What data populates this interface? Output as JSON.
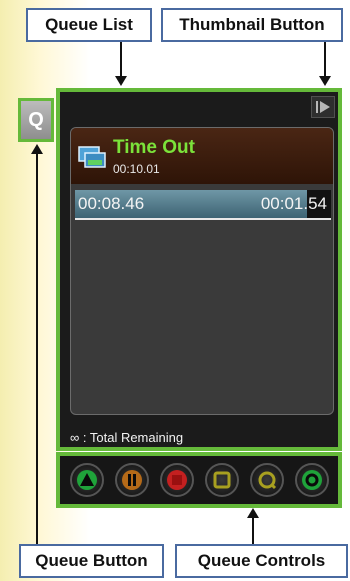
{
  "callouts": {
    "queue_list": "Queue List",
    "thumbnail_button": "Thumbnail Button",
    "queue_button": "Queue Button",
    "queue_controls": "Queue Controls"
  },
  "queue_button": {
    "label": "Q"
  },
  "item": {
    "title": "Time Out",
    "duration": "00:10.01",
    "elapsed": "00:08.46",
    "remaining": "00:01.54",
    "progress_fraction": 0.85
  },
  "footer": {
    "total_remaining": "∞ : Total Remaining"
  },
  "controls": [
    {
      "name": "play-icon",
      "color": "#1fa33a"
    },
    {
      "name": "pause-icon",
      "color": "#b56a18"
    },
    {
      "name": "stop-icon",
      "color": "#c42020"
    },
    {
      "name": "square-icon",
      "color": "#a8a020"
    },
    {
      "name": "loop-icon",
      "color": "#a8a020"
    },
    {
      "name": "refresh-icon",
      "color": "#1fa33a"
    }
  ],
  "colors": {
    "accent_green": "#65b93a",
    "title_green": "#7be23a"
  }
}
